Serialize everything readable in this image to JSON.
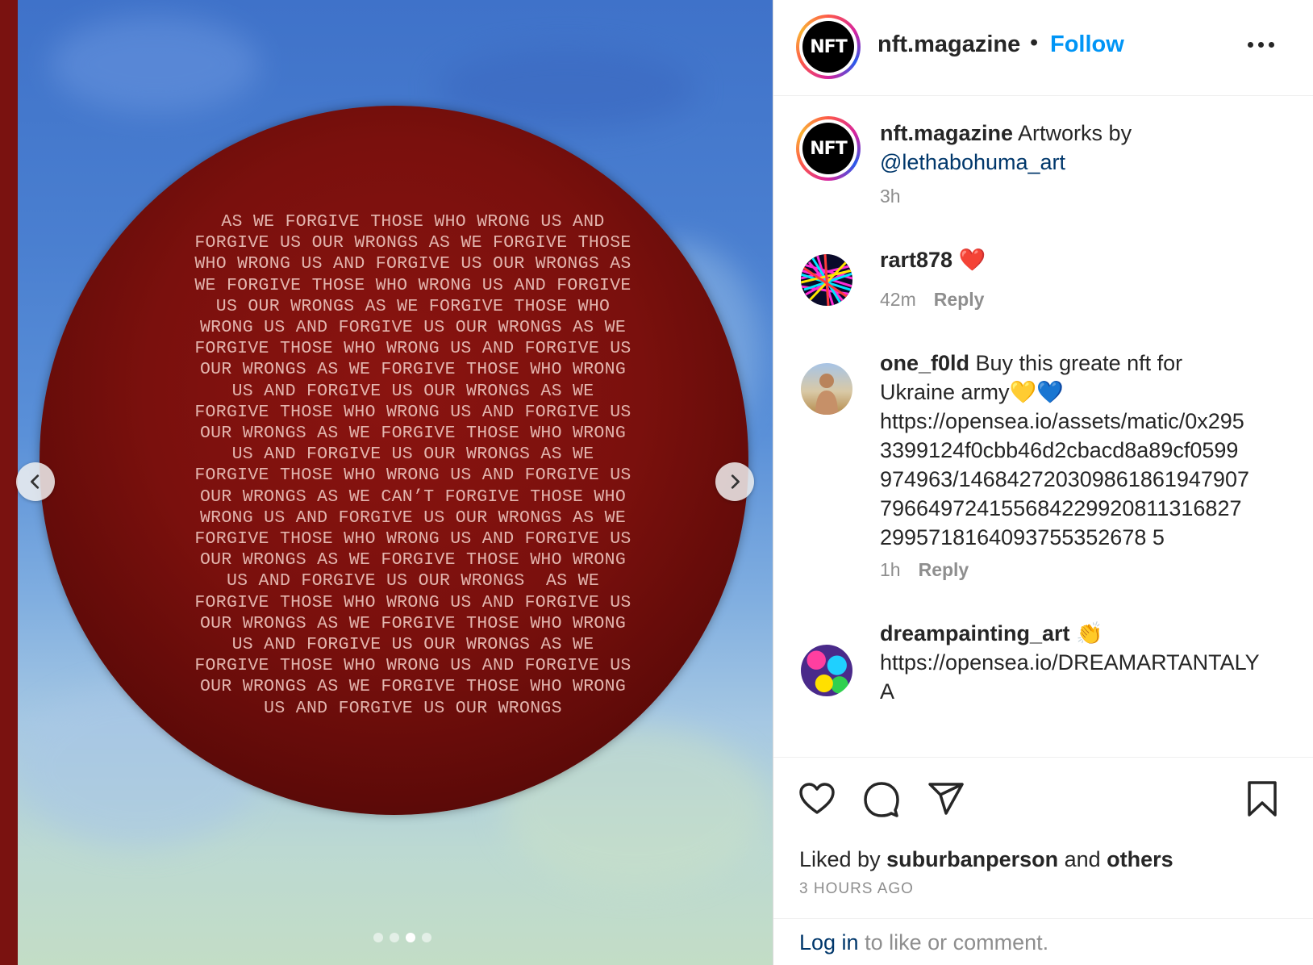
{
  "post": {
    "username": "nft.magazine",
    "bullet": "•",
    "follow_label": "Follow",
    "avatar_text": "NFT",
    "more_icon": "more-options-icon"
  },
  "media": {
    "poem": "AS WE FORGIVE THOSE WHO WRONG US AND\nFORGIVE US OUR WRONGS AS WE FORGIVE THOSE\nWHO WRONG US AND FORGIVE US OUR WRONGS AS\nWE FORGIVE THOSE WHO WRONG US AND FORGIVE\nUS OUR WRONGS AS WE FORGIVE THOSE WHO\nWRONG US AND FORGIVE US OUR WRONGS AS WE\nFORGIVE THOSE WHO WRONG US AND FORGIVE US\nOUR WRONGS AS WE FORGIVE THOSE WHO WRONG\nUS AND FORGIVE US OUR WRONGS AS WE\nFORGIVE THOSE WHO WRONG US AND FORGIVE US\nOUR WRONGS AS WE FORGIVE THOSE WHO WRONG\nUS AND FORGIVE US OUR WRONGS AS WE\nFORGIVE THOSE WHO WRONG US AND FORGIVE US\nOUR WRONGS AS WE CAN’T FORGIVE THOSE WHO\nWRONG US AND FORGIVE US OUR WRONGS AS WE\nFORGIVE THOSE WHO WRONG US AND FORGIVE US\nOUR WRONGS AS WE FORGIVE THOSE WHO WRONG\nUS AND FORGIVE US OUR WRONGS  AS WE\nFORGIVE THOSE WHO WRONG US AND FORGIVE US\nOUR WRONGS AS WE FORGIVE THOSE WHO WRONG\nUS AND FORGIVE US OUR WRONGS AS WE\nFORGIVE THOSE WHO WRONG US AND FORGIVE US\nOUR WRONGS AS WE FORGIVE THOSE WHO WRONG\nUS AND FORGIVE US OUR WRONGS",
    "carousel": {
      "count": 4,
      "active_index": 3
    },
    "colors": {
      "circle": "#7a100d",
      "sky": "#4a7fd0"
    }
  },
  "caption": {
    "username": "nft.magazine",
    "text": " Artworks by",
    "mention": "@lethabohuma_art",
    "time": "3h"
  },
  "comments": [
    {
      "username": "rart878",
      "text": " ❤️",
      "time": "42m",
      "reply_label": "Reply"
    },
    {
      "username": "one_f0ld",
      "text": " Buy this greate nft for\nUkraine army💛💙\nhttps://opensea.io/assets/matic/0x295\n3399124f0cbb46d2cbacd8a89cf0599\n974963/146842720309861861947907\n796649724155684229920811316827\n2995718164093755352678 5",
      "time": "1h",
      "reply_label": "Reply"
    },
    {
      "username": "dreampainting_art",
      "text": " 👏\nhttps://opensea.io/DREAMARTANTALY\nA"
    }
  ],
  "actions": {
    "like_icon": "heart-icon",
    "comment_icon": "comment-icon",
    "share_icon": "send-icon",
    "save_icon": "bookmark-icon"
  },
  "likes": {
    "prefix": "Liked by ",
    "user": "suburbanperson",
    "middle": " and ",
    "others": "others"
  },
  "time_ago": "3 HOURS AGO",
  "login": {
    "link": "Log in",
    "rest": " to like or comment."
  },
  "accent_color": "#0095f6"
}
